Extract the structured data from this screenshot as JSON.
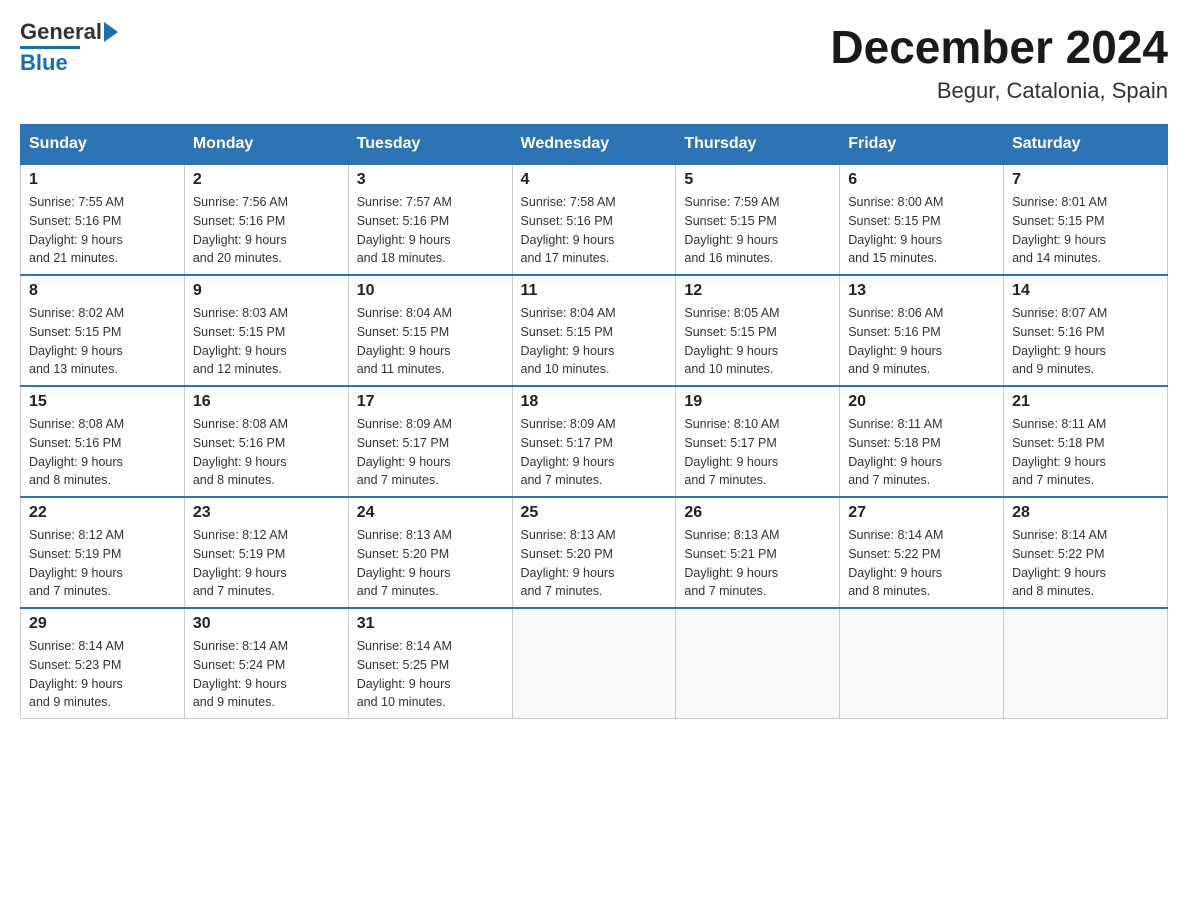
{
  "header": {
    "logo_general": "General",
    "logo_blue": "Blue",
    "title": "December 2024",
    "subtitle": "Begur, Catalonia, Spain"
  },
  "days_of_week": [
    "Sunday",
    "Monday",
    "Tuesday",
    "Wednesday",
    "Thursday",
    "Friday",
    "Saturday"
  ],
  "weeks": [
    [
      {
        "day": "1",
        "sunrise": "7:55 AM",
        "sunset": "5:16 PM",
        "daylight": "9 hours and 21 minutes."
      },
      {
        "day": "2",
        "sunrise": "7:56 AM",
        "sunset": "5:16 PM",
        "daylight": "9 hours and 20 minutes."
      },
      {
        "day": "3",
        "sunrise": "7:57 AM",
        "sunset": "5:16 PM",
        "daylight": "9 hours and 18 minutes."
      },
      {
        "day": "4",
        "sunrise": "7:58 AM",
        "sunset": "5:16 PM",
        "daylight": "9 hours and 17 minutes."
      },
      {
        "day": "5",
        "sunrise": "7:59 AM",
        "sunset": "5:15 PM",
        "daylight": "9 hours and 16 minutes."
      },
      {
        "day": "6",
        "sunrise": "8:00 AM",
        "sunset": "5:15 PM",
        "daylight": "9 hours and 15 minutes."
      },
      {
        "day": "7",
        "sunrise": "8:01 AM",
        "sunset": "5:15 PM",
        "daylight": "9 hours and 14 minutes."
      }
    ],
    [
      {
        "day": "8",
        "sunrise": "8:02 AM",
        "sunset": "5:15 PM",
        "daylight": "9 hours and 13 minutes."
      },
      {
        "day": "9",
        "sunrise": "8:03 AM",
        "sunset": "5:15 PM",
        "daylight": "9 hours and 12 minutes."
      },
      {
        "day": "10",
        "sunrise": "8:04 AM",
        "sunset": "5:15 PM",
        "daylight": "9 hours and 11 minutes."
      },
      {
        "day": "11",
        "sunrise": "8:04 AM",
        "sunset": "5:15 PM",
        "daylight": "9 hours and 10 minutes."
      },
      {
        "day": "12",
        "sunrise": "8:05 AM",
        "sunset": "5:15 PM",
        "daylight": "9 hours and 10 minutes."
      },
      {
        "day": "13",
        "sunrise": "8:06 AM",
        "sunset": "5:16 PM",
        "daylight": "9 hours and 9 minutes."
      },
      {
        "day": "14",
        "sunrise": "8:07 AM",
        "sunset": "5:16 PM",
        "daylight": "9 hours and 9 minutes."
      }
    ],
    [
      {
        "day": "15",
        "sunrise": "8:08 AM",
        "sunset": "5:16 PM",
        "daylight": "9 hours and 8 minutes."
      },
      {
        "day": "16",
        "sunrise": "8:08 AM",
        "sunset": "5:16 PM",
        "daylight": "9 hours and 8 minutes."
      },
      {
        "day": "17",
        "sunrise": "8:09 AM",
        "sunset": "5:17 PM",
        "daylight": "9 hours and 7 minutes."
      },
      {
        "day": "18",
        "sunrise": "8:09 AM",
        "sunset": "5:17 PM",
        "daylight": "9 hours and 7 minutes."
      },
      {
        "day": "19",
        "sunrise": "8:10 AM",
        "sunset": "5:17 PM",
        "daylight": "9 hours and 7 minutes."
      },
      {
        "day": "20",
        "sunrise": "8:11 AM",
        "sunset": "5:18 PM",
        "daylight": "9 hours and 7 minutes."
      },
      {
        "day": "21",
        "sunrise": "8:11 AM",
        "sunset": "5:18 PM",
        "daylight": "9 hours and 7 minutes."
      }
    ],
    [
      {
        "day": "22",
        "sunrise": "8:12 AM",
        "sunset": "5:19 PM",
        "daylight": "9 hours and 7 minutes."
      },
      {
        "day": "23",
        "sunrise": "8:12 AM",
        "sunset": "5:19 PM",
        "daylight": "9 hours and 7 minutes."
      },
      {
        "day": "24",
        "sunrise": "8:13 AM",
        "sunset": "5:20 PM",
        "daylight": "9 hours and 7 minutes."
      },
      {
        "day": "25",
        "sunrise": "8:13 AM",
        "sunset": "5:20 PM",
        "daylight": "9 hours and 7 minutes."
      },
      {
        "day": "26",
        "sunrise": "8:13 AM",
        "sunset": "5:21 PM",
        "daylight": "9 hours and 7 minutes."
      },
      {
        "day": "27",
        "sunrise": "8:14 AM",
        "sunset": "5:22 PM",
        "daylight": "9 hours and 8 minutes."
      },
      {
        "day": "28",
        "sunrise": "8:14 AM",
        "sunset": "5:22 PM",
        "daylight": "9 hours and 8 minutes."
      }
    ],
    [
      {
        "day": "29",
        "sunrise": "8:14 AM",
        "sunset": "5:23 PM",
        "daylight": "9 hours and 9 minutes."
      },
      {
        "day": "30",
        "sunrise": "8:14 AM",
        "sunset": "5:24 PM",
        "daylight": "9 hours and 9 minutes."
      },
      {
        "day": "31",
        "sunrise": "8:14 AM",
        "sunset": "5:25 PM",
        "daylight": "9 hours and 10 minutes."
      },
      null,
      null,
      null,
      null
    ]
  ],
  "labels": {
    "sunrise_prefix": "Sunrise: ",
    "sunset_prefix": "Sunset: ",
    "daylight_prefix": "Daylight: "
  }
}
